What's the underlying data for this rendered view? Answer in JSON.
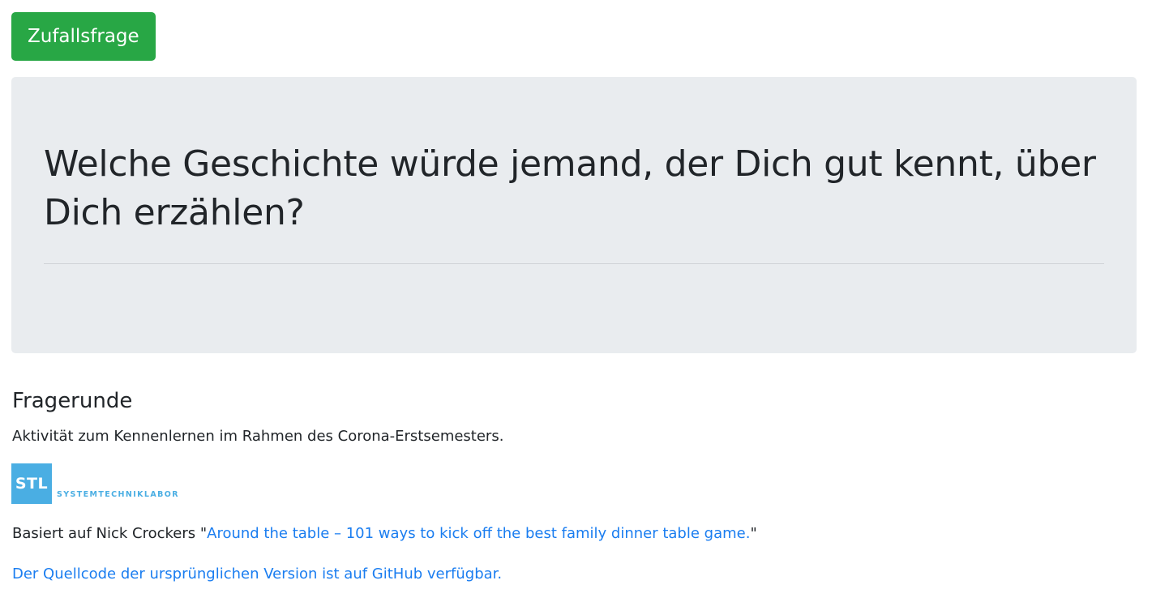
{
  "toolbar": {
    "random_button_label": "Zufallsfrage"
  },
  "question": {
    "text": "Welche Geschichte würde jemand, der Dich gut kennt, über Dich erzählen?"
  },
  "info": {
    "title": "Fragerunde",
    "description": "Aktivität zum Kennenlernen im Rahmen des Corona-Erstsemesters.",
    "logo": {
      "abbr": "STL",
      "name": "SYSTEMTECHNIKLABOR",
      "color": "#4aaee3"
    },
    "credit_prefix": "Basiert auf Nick Crockers \"",
    "credit_link": "Around the table – 101 ways to kick off the best family dinner table game.",
    "credit_suffix": "\"",
    "source_link": "Der Quellcode der ursprünglichen Version ist auf GitHub verfügbar."
  },
  "colors": {
    "button": "#28a745",
    "jumbotron": "#e9ecef",
    "link": "#1a7df0"
  }
}
